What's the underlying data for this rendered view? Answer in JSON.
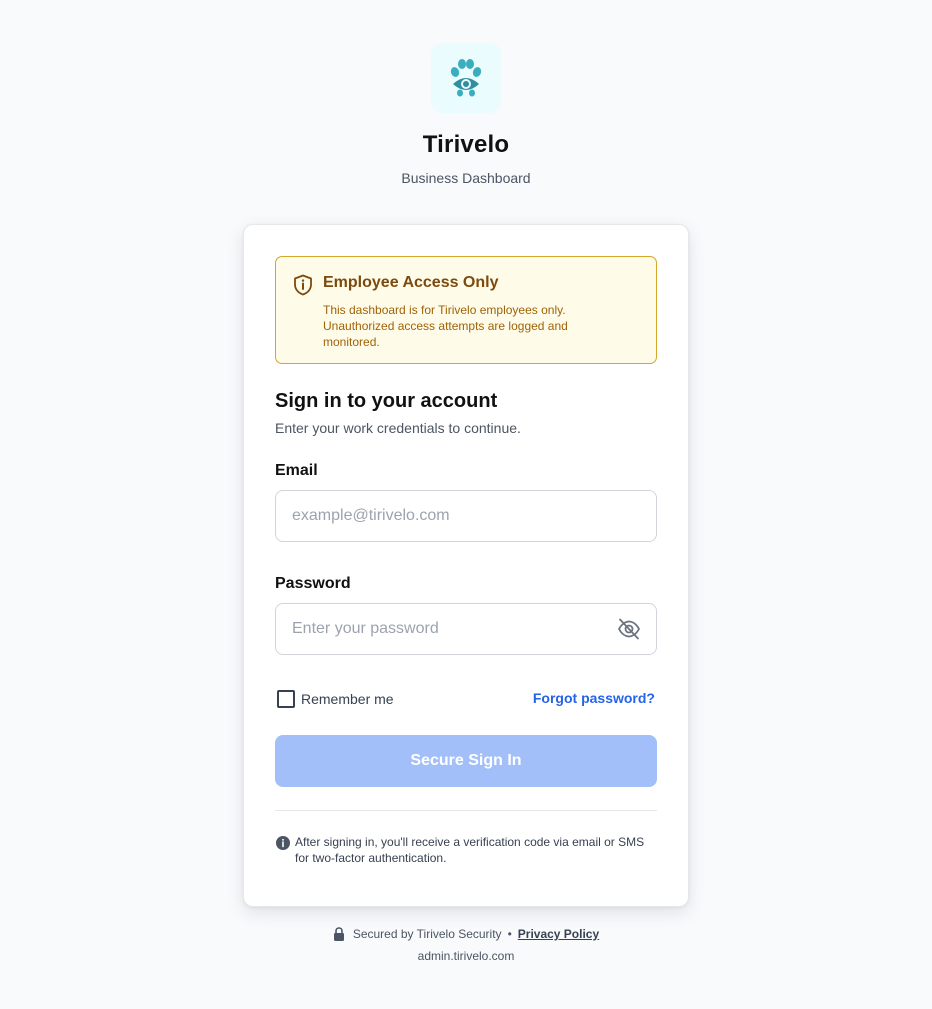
{
  "brand": {
    "name": "Tirivelo",
    "subtitle": "Business Dashboard",
    "logo_icon": "paw-eye-icon",
    "accent_color": "#3aaebf"
  },
  "alert": {
    "icon": "shield-info-icon",
    "title": "Employee Access Only",
    "message": "This dashboard is for Tirivelo employees only. Unauthorized access attempts are logged and monitored."
  },
  "signin": {
    "heading": "Sign in to your account",
    "subheading": "Enter your work credentials to continue.",
    "email": {
      "label": "Email",
      "placeholder": "example@tirivelo.com",
      "value": ""
    },
    "password": {
      "label": "Password",
      "placeholder": "Enter your password",
      "value": "",
      "toggle_icon": "eye-off-icon"
    },
    "remember_label": "Remember me",
    "remember_checked": false,
    "forgot_label": "Forgot password?",
    "submit_label": "Secure Sign In",
    "info_icon": "info-icon",
    "info_text": "After signing in, you'll receive a verification code via email or SMS for two-factor authentication."
  },
  "footer": {
    "lock_icon": "lock-icon",
    "secured_text": "Secured by Tirivelo Security",
    "separator": "•",
    "privacy_label": "Privacy Policy",
    "domain": "admin.tirivelo.com"
  }
}
